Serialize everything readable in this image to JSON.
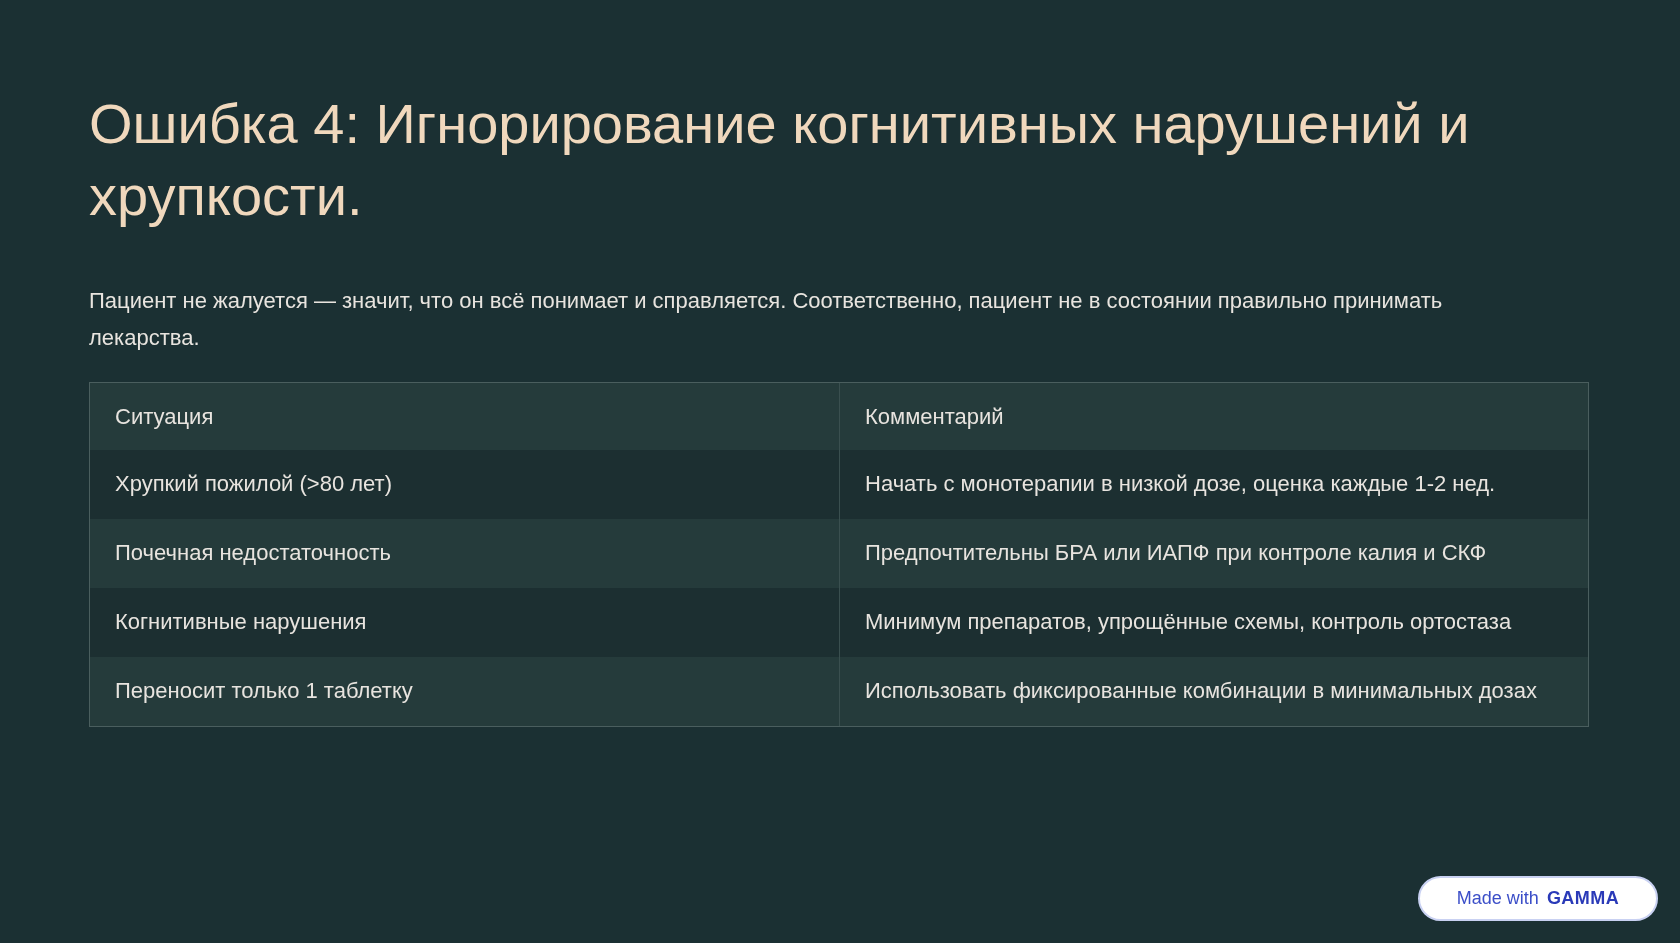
{
  "title": "Ошибка 4: Игнорирование когнитивных нарушений и хрупкости.",
  "paragraph": "Пациент не жалуется — значит, что он всё понимает и справляется. Соответственно, пациент не в состоянии правильно принимать лекарства.",
  "table": {
    "columns": [
      "Ситуация",
      "Комментарий"
    ],
    "rows": [
      [
        "Хрупкий пожилой (>80 лет)",
        "Начать с монотерапии в низкой дозе, оценка каждые 1-2 нед."
      ],
      [
        "Почечная недостаточность",
        "Предпочтительны БРА или ИАПФ при контроле калия и СКФ"
      ],
      [
        "Когнитивные нарушения",
        "Минимум препаратов, упрощённые схемы, контроль ортостаза"
      ],
      [
        "Переносит только 1 таблетку",
        "Использовать фиксированные комбинации в минимальных дозах"
      ]
    ]
  },
  "badge": {
    "text": "Made with",
    "brand": "GAMMA"
  }
}
